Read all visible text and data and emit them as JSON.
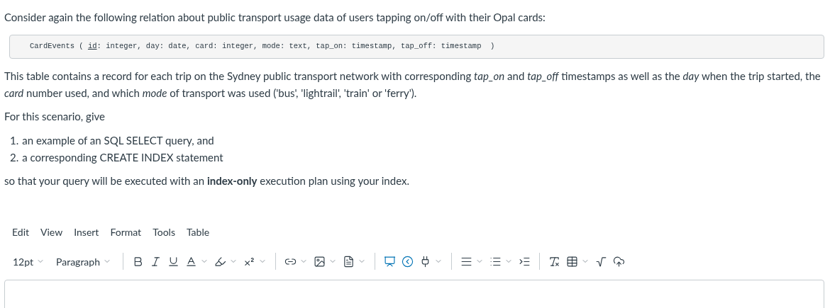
{
  "intro": "Consider again the following relation about public transport usage data of users tapping on/off with their Opal cards:",
  "schema": {
    "relation": "CardEvents (",
    "key": "id",
    "rest": ": integer, day: date, card: integer, mode: text, tap_on: timestamp, tap_off: timestamp",
    "close": ")"
  },
  "description": "This table contains a record for each trip on the Sydney public transport network with corresponding *tap_on* and *tap_off* timestamps as well as the *day* when the trip started, the *card* number used, and which *mode* of transport was used ('bus', 'lightrail', 'train' or 'ferry').",
  "prompt": "For this scenario, give",
  "tasks": [
    {
      "number": "1.",
      "text": "an example of an SQL SELECT query, and"
    },
    {
      "number": "2.",
      "text": "a corresponding CREATE INDEX statement"
    }
  ],
  "closing": "so that your query will be executed with an **index-only** execution plan using your index.",
  "editor": {
    "menu": [
      "Edit",
      "View",
      "Insert",
      "Format",
      "Tools",
      "Table"
    ],
    "font_size": "12pt",
    "block_format": "Paragraph"
  }
}
